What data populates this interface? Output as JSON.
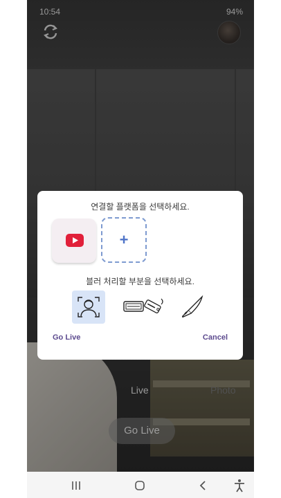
{
  "status_bar": {
    "time": "10:54",
    "right": "94%"
  },
  "camera": {
    "mode_live": "Live",
    "mode_photo": "Photo",
    "go_live_button": "Go Live"
  },
  "dialog": {
    "platform_prompt": "연결할 플랫폼을 선택하세요.",
    "blur_prompt": "블러 처리할 부분을 선택하세요.",
    "platforms": [
      "youtube-icon",
      "add-platform"
    ],
    "add_symbol": "+",
    "blur_options": [
      "face-icon",
      "license-plate-icon",
      "knife-icon"
    ],
    "go_live_label": "Go Live",
    "cancel_label": "Cancel"
  },
  "colors": {
    "accent": "#5c4a8e",
    "youtube_red": "#e1203a",
    "selected_option_bg": "#d8e4f7",
    "add_border": "#7d9ad0"
  },
  "nav_bar": {
    "items": [
      "recents-icon",
      "home-icon",
      "back-icon",
      "accessibility-icon"
    ]
  }
}
